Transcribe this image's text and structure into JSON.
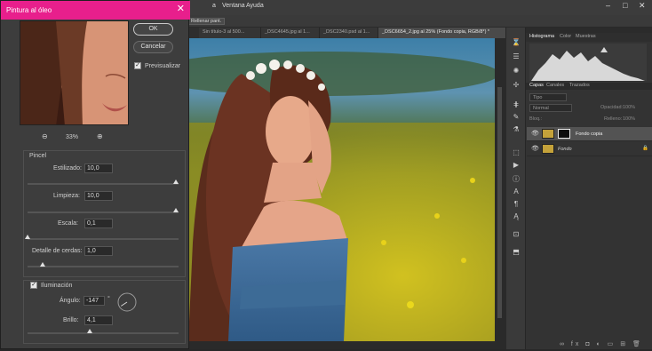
{
  "menubar": {
    "items": [
      "a",
      "Ventana",
      "Ayuda"
    ],
    "right_label": "Rellenar pant."
  },
  "document_tabs": [
    {
      "label": "Sin título-3 al 500...",
      "active": false
    },
    {
      "label": "_DSC4645.jpg al 1...",
      "active": false
    },
    {
      "label": "_DSC2340.psd al 1...",
      "active": false
    },
    {
      "label": "_DSC6654_2.jpg al 25% (Fondo copia, RGB/8*) *",
      "active": true
    }
  ],
  "dialog": {
    "title": "Pintura al óleo",
    "ok_label": "OK",
    "cancel_label": "Cancelar",
    "preview_label": "Previsualizar",
    "preview_checked": true,
    "zoom_value": "33%",
    "brush_group_label": "Pincel",
    "params": [
      {
        "label": "Estilizado:",
        "value": "10,0",
        "slider": 0.98
      },
      {
        "label": "Limpieza:",
        "value": "10,0",
        "slider": 0.98
      },
      {
        "label": "Escala:",
        "value": "0,1",
        "slider": 0.0
      },
      {
        "label": "Detalle de cerdas:",
        "value": "1,0",
        "slider": 0.1
      }
    ],
    "lighting_label": "Iluminación",
    "lighting_checked": true,
    "angle_label": "Ángulo:",
    "angle_value": "-147",
    "angle_unit": "°",
    "shine_label": "Brillo:",
    "shine_value": "4,1",
    "shine_slider": 0.41
  },
  "panels": {
    "top_tabs": [
      "Histograma",
      "Color",
      "Muestras"
    ],
    "layer_tabs": [
      "Capas",
      "Canales",
      "Trazados"
    ],
    "kind_placeholder": "Tipo",
    "blend_mode": "Normal",
    "opacity_label": "Opacidad:",
    "opacity_value": "100%",
    "lock_label": "Bloq.:",
    "fill_label": "Relleno:",
    "fill_value": "100%",
    "layers": [
      {
        "name": "Fondo copia",
        "selected": true,
        "locked": false
      },
      {
        "name": "Fondo",
        "selected": false,
        "locked": true
      }
    ]
  },
  "colors": {
    "title_bar": "#e81f8c",
    "dialog_bg": "#3d3d3d",
    "panel_bg": "#333333"
  }
}
